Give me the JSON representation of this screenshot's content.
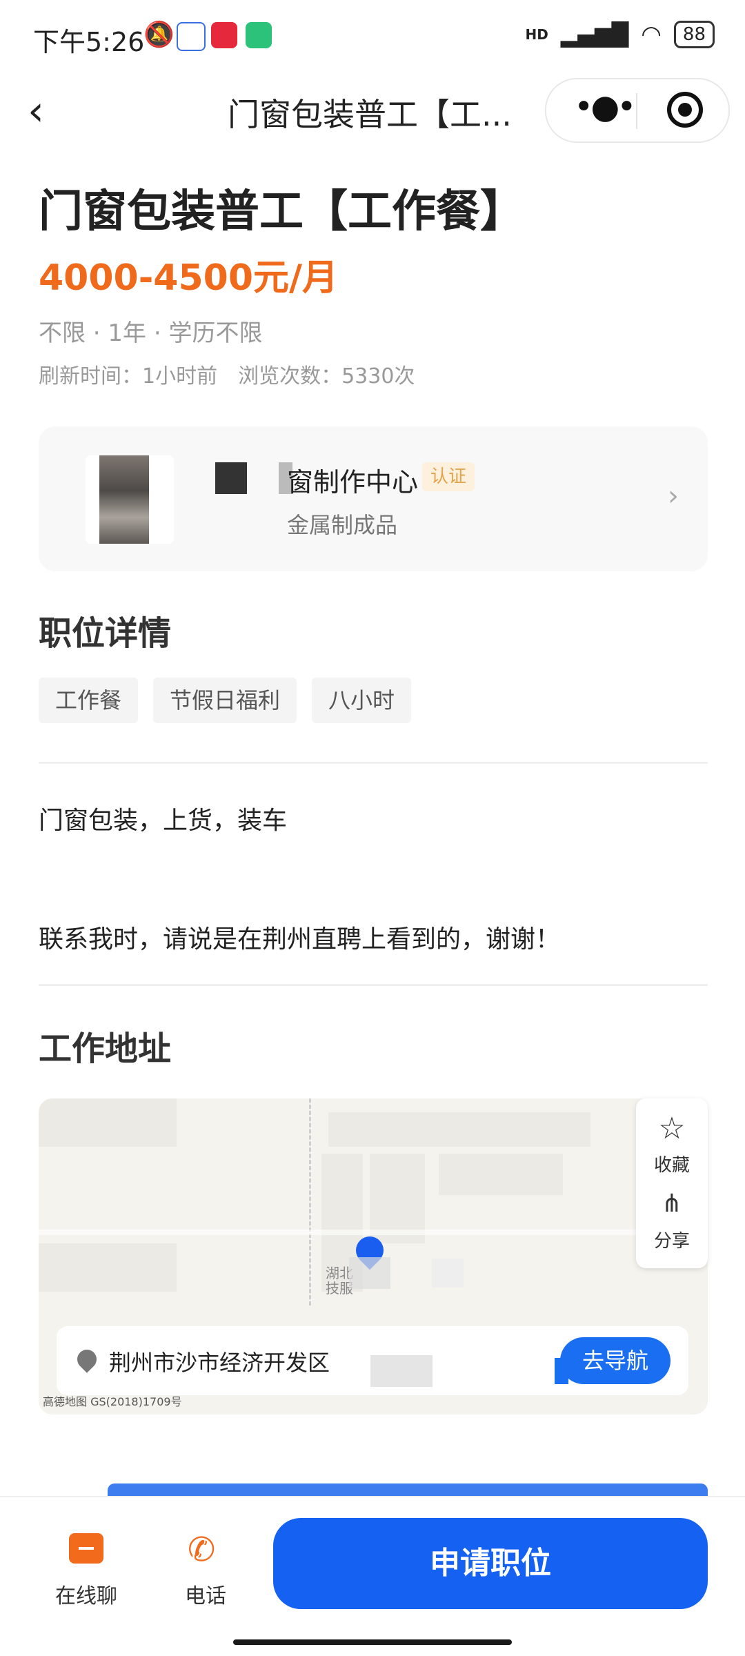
{
  "status_bar": {
    "time": "下午5:26",
    "hd": "HD",
    "battery": "88"
  },
  "nav": {
    "back_icon": "chevron-left-icon",
    "title": "门窗包装普工【工...",
    "more_icon": "more-dots-icon",
    "close_icon": "target-icon"
  },
  "job": {
    "title": "门窗包装普工【工作餐】",
    "salary": "4000-4500元/月",
    "meta": "不限 · 1年 · 学历不限",
    "stats": "刷新时间：1小时前　浏览次数：5330次",
    "salary_color": "#f06a1c"
  },
  "company": {
    "name": "窗制作中心",
    "badge": "认证",
    "industry": "金属制成品",
    "chevron_icon": "chevron-right-icon"
  },
  "details": {
    "section_title": "职位详情",
    "tags": [
      "工作餐",
      "节假日福利",
      "八小时"
    ],
    "description_line1": "门窗包装，上货，装车",
    "description_line2": "联系我时，请说是在荆州直聘上看到的，谢谢！"
  },
  "address": {
    "section_title": "工作地址",
    "map_label_1": "湖北",
    "map_label_2": "技服",
    "address_text": "荆州市沙市经济开发区",
    "navigate_button": "去导航",
    "collect_label": "收藏",
    "share_label": "分享",
    "map_credit": "高德地图 GS(2018)1709号"
  },
  "bottom": {
    "chat_label": "在线聊",
    "phone_label": "电话",
    "apply_label": "申请职位",
    "accent_color": "#1561f1"
  }
}
